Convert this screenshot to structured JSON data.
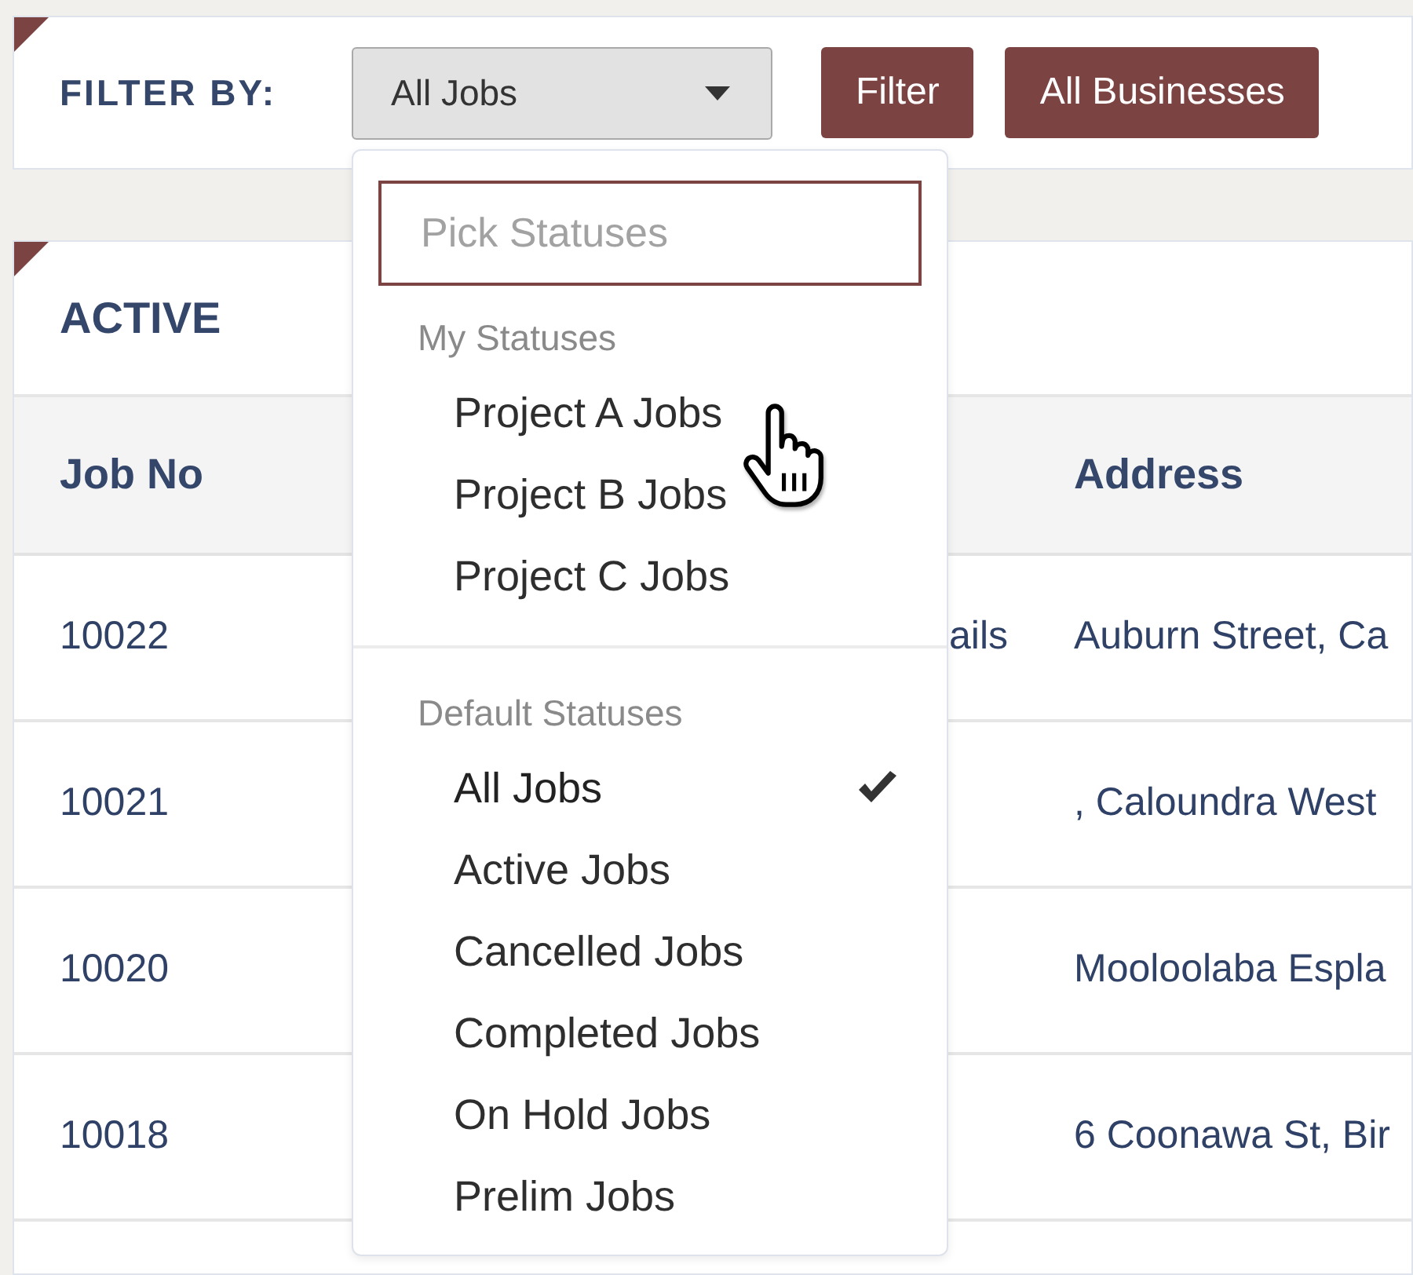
{
  "filter_bar": {
    "label": "FILTER BY:",
    "select": {
      "value": "All Jobs",
      "expanded": true
    },
    "buttons": [
      "Filter",
      "All Businesses"
    ]
  },
  "status_dropdown": {
    "search": {
      "placeholder": "Pick Statuses"
    },
    "groups": [
      {
        "label": "My Statuses",
        "items": [
          {
            "label": "Project A Jobs",
            "selected": false
          },
          {
            "label": "Project B Jobs",
            "selected": false
          },
          {
            "label": "Project C Jobs",
            "selected": false
          }
        ]
      },
      {
        "label": "Default Statuses",
        "items": [
          {
            "label": "All Jobs",
            "selected": true
          },
          {
            "label": "Active Jobs",
            "selected": false
          },
          {
            "label": "Cancelled Jobs",
            "selected": false
          },
          {
            "label": "Completed Jobs",
            "selected": false
          },
          {
            "label": "On Hold Jobs",
            "selected": false
          },
          {
            "label": "Prelim Jobs",
            "selected": false
          }
        ]
      }
    ]
  },
  "jobs_panel": {
    "title": "ACTIVE",
    "table": {
      "columns": {
        "job_no": "Job No",
        "address": "Address"
      },
      "rows": [
        {
          "job_no": "10022",
          "column_2": "ails",
          "address": "Auburn Street, Ca"
        },
        {
          "job_no": "10021",
          "address": ", Caloundra West"
        },
        {
          "job_no": "10020",
          "address": "Mooloolaba Espla"
        },
        {
          "job_no": "10018",
          "address": "6 Coonawa St, Bir"
        }
      ]
    }
  }
}
